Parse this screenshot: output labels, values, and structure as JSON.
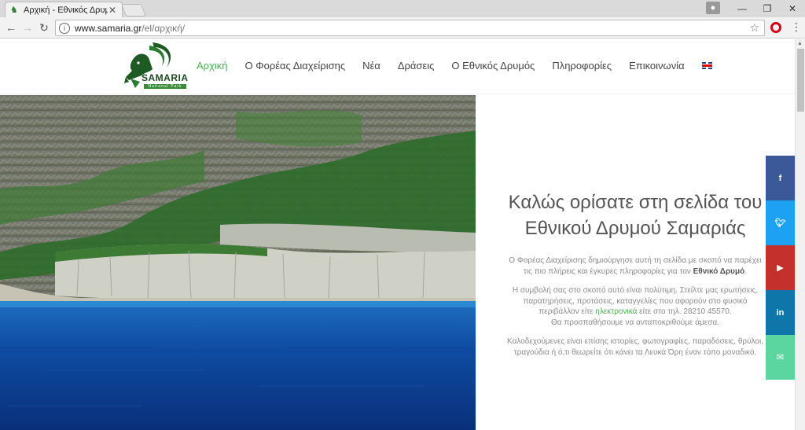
{
  "browser": {
    "tab_title": "Αρχική - Εθνικός Δρυμό",
    "url_host": "www.samaria.gr",
    "url_path": "/el/αρχική/"
  },
  "site": {
    "logo_word": "SAMARIA",
    "logo_tag": "National Park",
    "nav": [
      {
        "label": "Αρχική",
        "active": true
      },
      {
        "label": "Ο Φορέας Διαχείρισης"
      },
      {
        "label": "Νέα"
      },
      {
        "label": "Δράσεις"
      },
      {
        "label": "Ο Εθνικός Δρυμός"
      },
      {
        "label": "Πληροφορίες"
      },
      {
        "label": "Επικοινωνία"
      }
    ],
    "lang_flag": "english-flag-icon"
  },
  "welcome": {
    "title_line1": "Καλώς ορίσατε στη σελίδα του",
    "title_line2": "Εθνικού Δρυμού Σαμαριάς",
    "p1_a": "Ο Φορέας Διαχείρισης δημιούργησε αυτή τη σελίδα με σκοπό να παρέχει",
    "p1_b": "τις πιο πλήρεις και έγκυρες πληροφορίες για τον",
    "p1_bold": "Εθνικό Δρυμό",
    "p1_end": ".",
    "p2_a": "Η συμβολή σας στο σκοπό αυτό είναι πολύτιμη. Στείλτε μας ερωτήσεις,",
    "p2_b": "παρατηρήσεις, προτάσεις, καταγγελίες που αφορούν στο φυσικό",
    "p2_c_pre": "περιβάλλον είτε",
    "p2_link": "ηλεκτρονικά",
    "p2_c_post": "είτε στο τηλ. 28210 45570.",
    "p2_d": "Θα προσπαθήσουμε να ανταποκριθούμε άμεσα.",
    "p3_a": "Καλοδεχούμενες είναι επίσης ιστορίες, φωτογραφίες, παραδόσεις, θρύλοι,",
    "p3_b": "τραγούδια ή ό,τι θεωρείτε ότι κάνει τα Λευκά Όρη έναν τόπο μοναδικό."
  },
  "social": [
    {
      "name": "facebook",
      "glyph": "f",
      "color": "#3b5998"
    },
    {
      "name": "twitter",
      "glyph": "t",
      "color": "#1da1f2"
    },
    {
      "name": "youtube",
      "glyph": "▶",
      "color": "#c4302b"
    },
    {
      "name": "linkedin",
      "glyph": "in",
      "color": "#0e76a8"
    },
    {
      "name": "email",
      "glyph": "✉",
      "color": "#5cd6a0"
    }
  ],
  "colors": {
    "accent": "#4caf50"
  }
}
